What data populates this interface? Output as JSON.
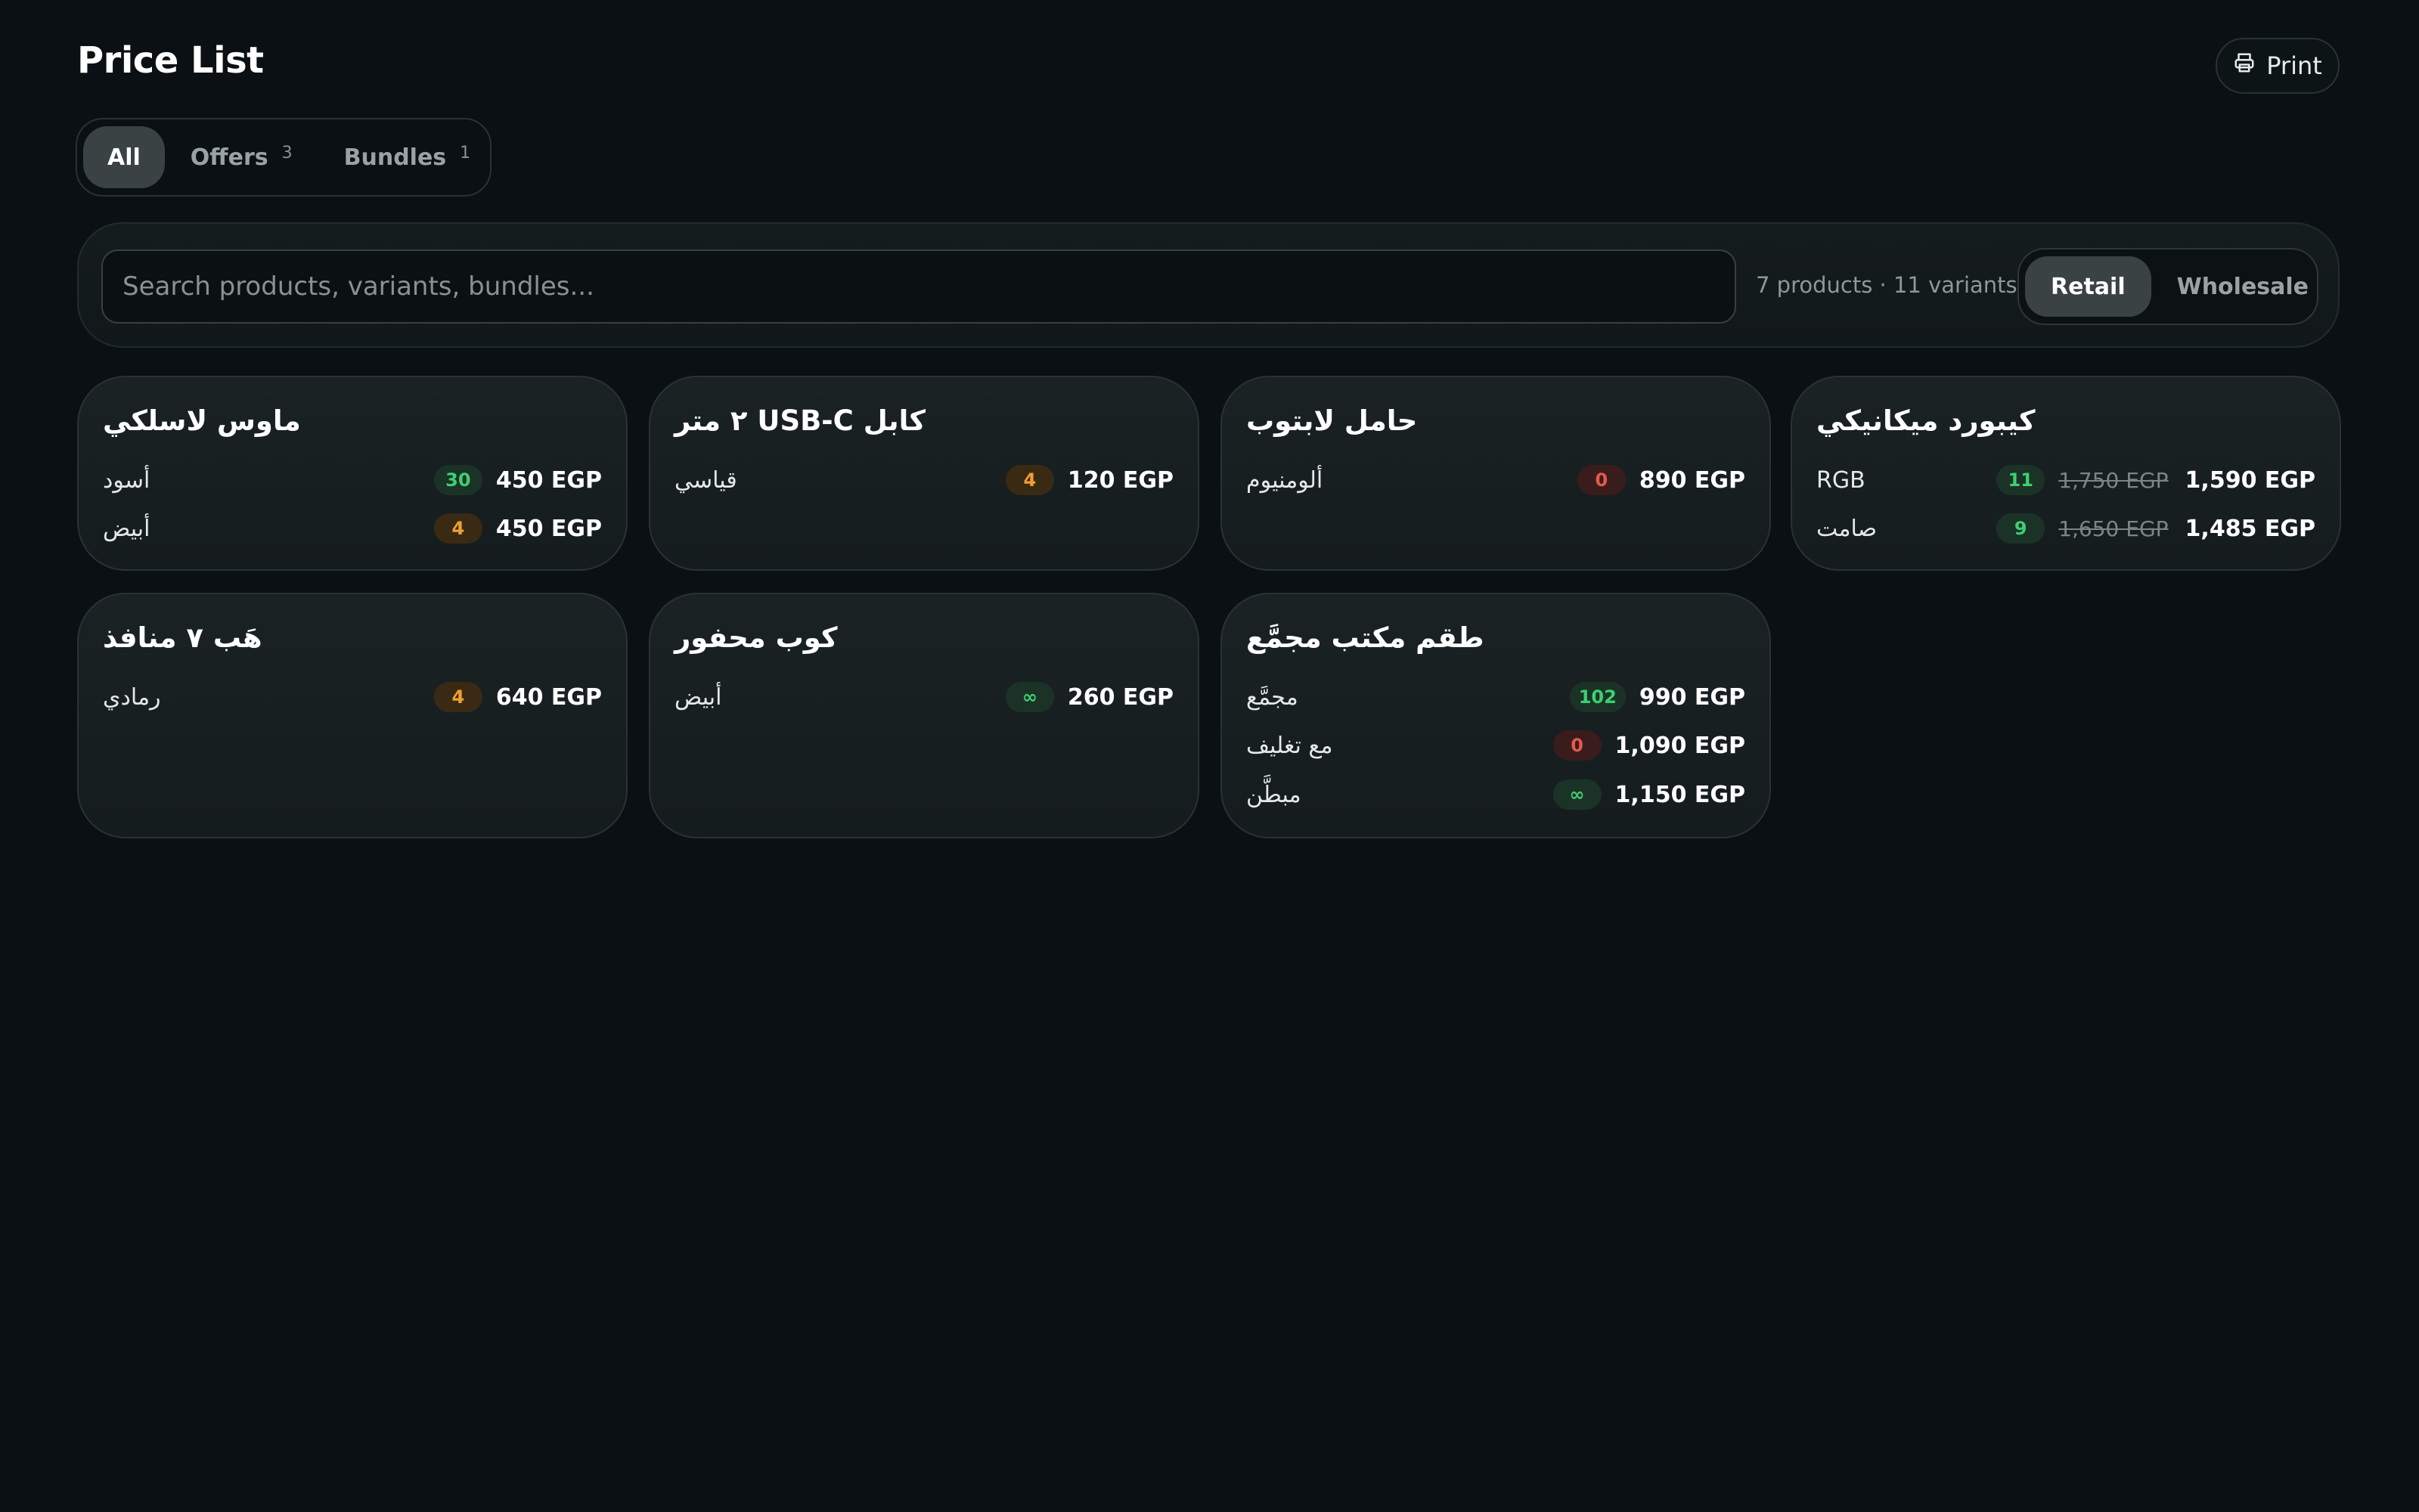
{
  "page": {
    "title": "Price List",
    "print_label": "Print"
  },
  "tabs": [
    {
      "label": "All",
      "count": ""
    },
    {
      "label": "Offers",
      "count": "3"
    },
    {
      "label": "Bundles",
      "count": "1"
    }
  ],
  "search": {
    "placeholder": "Search products, variants, bundles..."
  },
  "summary": "7 products · 11 variants",
  "modes": [
    {
      "label": "Retail"
    },
    {
      "label": "Wholesale"
    }
  ],
  "colors": {
    "green": "#3ecf73",
    "orange": "#f0a030",
    "red": "#e35a4e",
    "background": "#0a1013"
  },
  "cards": [
    {
      "title": "ماوس لاسلكي",
      "variants": [
        {
          "name": "أسود",
          "stock": "30",
          "old_price": "",
          "price": "450 EGP"
        },
        {
          "name": "أبيض",
          "stock": "4",
          "old_price": "",
          "price": "450 EGP"
        }
      ]
    },
    {
      "title": "كابل USB-C ٢ متر",
      "variants": [
        {
          "name": "قياسي",
          "stock": "4",
          "old_price": "",
          "price": "120 EGP"
        }
      ]
    },
    {
      "title": "حامل لابتوب",
      "variants": [
        {
          "name": "ألومنيوم",
          "stock": "0",
          "old_price": "",
          "price": "890 EGP"
        }
      ]
    },
    {
      "title": "كيبورد ميكانيكي",
      "variants": [
        {
          "name": "RGB",
          "stock": "11",
          "old_price": "1,750 EGP",
          "price": "1,590 EGP"
        },
        {
          "name": "صامت",
          "stock": "9",
          "old_price": "1,650 EGP",
          "price": "1,485 EGP"
        }
      ]
    },
    {
      "title": "هَب ٧ منافذ",
      "variants": [
        {
          "name": "رمادي",
          "stock": "4",
          "old_price": "",
          "price": "640 EGP"
        }
      ]
    },
    {
      "title": "كوب محفور",
      "variants": [
        {
          "name": "أبيض",
          "stock": "∞",
          "old_price": "",
          "price": "260 EGP"
        }
      ]
    },
    {
      "title": "طقم مكتب مجمَّع",
      "variants": [
        {
          "name": "مجمَّع",
          "stock": "102",
          "old_price": "",
          "price": "990 EGP"
        },
        {
          "name": "مع تغليف",
          "stock": "0",
          "old_price": "",
          "price": "1,090 EGP"
        },
        {
          "name": "مبطَّن",
          "stock": "∞",
          "old_price": "",
          "price": "1,150 EGP"
        }
      ]
    }
  ]
}
